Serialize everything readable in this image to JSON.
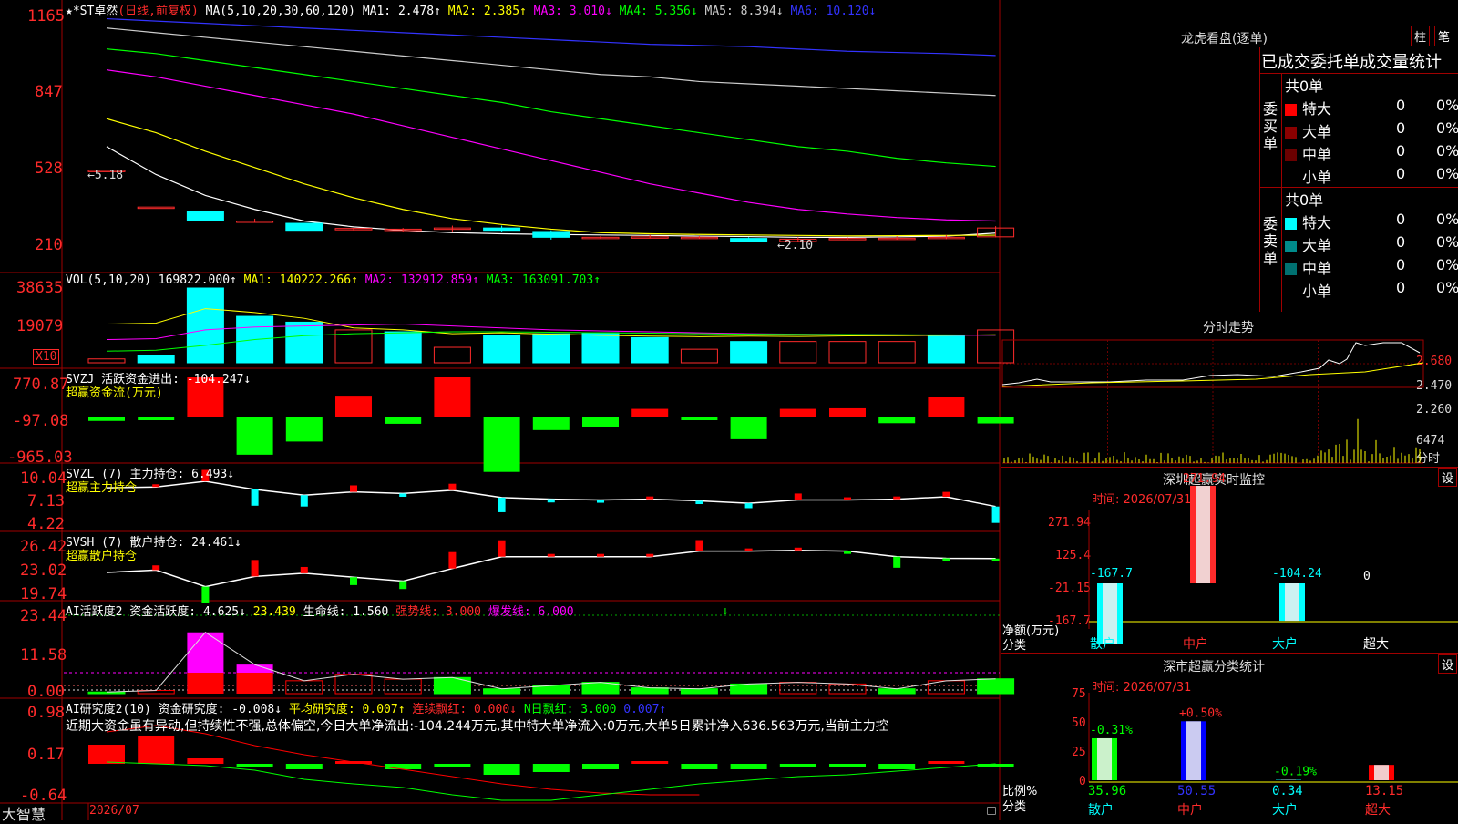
{
  "colors": {
    "up": "#ff2b2b",
    "down": "#00ffff",
    "bg": "#000000",
    "border": "#a00000",
    "yellow": "#ffff00",
    "white": "#ffffff",
    "green": "#00ff00",
    "magenta": "#ff00ff"
  },
  "main": {
    "title": "★*ST卓然",
    "period": "(日线,前复权)",
    "ma_head": "MA(5,10,20,30,60,120)",
    "ma": [
      {
        "label": "MA1: 2.478↑",
        "color": "#ffffff"
      },
      {
        "label": "MA2: 2.385↑",
        "color": "#ffff00"
      },
      {
        "label": "MA3: 3.010↓",
        "color": "#ff00ff"
      },
      {
        "label": "MA4: 5.356↓",
        "color": "#00ff00"
      },
      {
        "label": "MA5: 8.394↓",
        "color": "#cccccc"
      },
      {
        "label": "MA6: 10.120↓",
        "color": "#3333ff"
      }
    ],
    "yticks": [
      "1165",
      "847",
      "528",
      "210"
    ],
    "hi_mark": "←5.18",
    "lo_mark": "←2.10"
  },
  "vol": {
    "head": "VOL(5,10,20)",
    "value": "169822.000↑",
    "ma1": "MA1: 140222.266↑",
    "ma2": "MA2: 132912.859↑",
    "ma3": "MA3: 163091.703↑",
    "yticks": [
      "38635",
      "19079"
    ],
    "unit": "X10"
  },
  "svzj": {
    "head": "SVZJ  活跃资金进出: -104.247↓",
    "sub": "超赢资金流(万元)",
    "yticks": [
      "770.87",
      "-97.08",
      "-965.03"
    ]
  },
  "svzl": {
    "head": "SVZL (7) 主力持仓: 6.493↓",
    "sub": "超赢主力持仓",
    "yticks": [
      "10.04",
      "7.13",
      "4.22"
    ]
  },
  "svsh": {
    "head": "SVSH (7) 散户持仓: 24.461↓",
    "sub": "超赢散户持仓",
    "yticks": [
      "26.42",
      "23.02",
      "19.74"
    ]
  },
  "ai1": {
    "head": "AI活跃度2 资金活跃度:",
    "v1": "4.625↓",
    "v2": "23.439",
    "life": "生命线: 1.560",
    "strong": "强势线: 3.000",
    "burst": "爆发线: 6.000",
    "yticks": [
      "23.44",
      "11.58",
      "0.00"
    ]
  },
  "ai2": {
    "head": "AI研究度2(10) 资金研究度:",
    "v1": "-0.008↓",
    "avg": "平均研究度: 0.007↑",
    "lian": "连续飘红: 0.000↓",
    "nday": "N日飘红: 3.000",
    "last": "0.007↑",
    "comment": "近期大资金虽有异动,但持续性不强,总体偏空,今日大单净流出:-104.244万元,其中特大单净流入:0万元,大单5日累计净入636.563万元,当前主力控",
    "yticks": [
      "0.98",
      "0.17",
      "-0.64"
    ]
  },
  "bottom": {
    "brand": "大智慧",
    "date": "2026/07"
  },
  "chart_data": [
    {
      "type": "candlestick",
      "title": "★*ST卓然",
      "yticks": [
        1165,
        847,
        528,
        210
      ],
      "ohlc": [
        [
          5.18,
          5.18,
          5.18,
          5.18
        ],
        [
          3.6,
          3.6,
          3.6,
          3.6
        ],
        [
          3.4,
          3.4,
          3.0,
          3.0
        ],
        [
          3.0,
          3.1,
          2.95,
          3.0
        ],
        [
          2.9,
          2.9,
          2.6,
          2.6
        ],
        [
          2.62,
          2.7,
          2.6,
          2.68
        ],
        [
          2.6,
          2.7,
          2.55,
          2.65
        ],
        [
          2.65,
          2.8,
          2.55,
          2.7
        ],
        [
          2.7,
          2.8,
          2.55,
          2.6
        ],
        [
          2.55,
          2.6,
          2.2,
          2.3
        ],
        [
          2.3,
          2.35,
          2.25,
          2.3
        ],
        [
          2.3,
          2.4,
          2.25,
          2.32
        ],
        [
          2.3,
          2.35,
          2.25,
          2.3
        ],
        [
          2.25,
          2.3,
          2.1,
          2.12
        ],
        [
          2.12,
          2.3,
          2.1,
          2.22
        ],
        [
          2.22,
          2.3,
          2.2,
          2.25
        ],
        [
          2.24,
          2.34,
          2.2,
          2.26
        ],
        [
          2.26,
          2.4,
          2.22,
          2.3
        ],
        [
          2.32,
          2.78,
          2.3,
          2.7
        ]
      ],
      "ma": [
        {
          "name": "MA1",
          "values": [
            6.2,
            5.0,
            4.1,
            3.5,
            3.0,
            2.75,
            2.6,
            2.5,
            2.45,
            2.42,
            2.4,
            2.38,
            2.35,
            2.33,
            2.3,
            2.3,
            2.32,
            2.35,
            2.48
          ]
        },
        {
          "name": "MA2",
          "values": [
            7.4,
            6.8,
            6.0,
            5.3,
            4.6,
            4.0,
            3.5,
            3.1,
            2.85,
            2.65,
            2.5,
            2.45,
            2.42,
            2.4,
            2.38,
            2.36,
            2.37,
            2.38,
            2.39
          ]
        },
        {
          "name": "MA3",
          "values": [
            9.5,
            9.2,
            8.8,
            8.4,
            8.0,
            7.6,
            7.1,
            6.6,
            6.1,
            5.6,
            5.1,
            4.6,
            4.2,
            3.8,
            3.5,
            3.3,
            3.15,
            3.05,
            3.0
          ]
        },
        {
          "name": "MA4",
          "values": [
            10.4,
            10.2,
            9.9,
            9.6,
            9.3,
            9.0,
            8.7,
            8.4,
            8.1,
            7.7,
            7.4,
            7.1,
            6.8,
            6.5,
            6.2,
            6.0,
            5.7,
            5.5,
            5.35
          ]
        },
        {
          "name": "MA5",
          "values": [
            11.3,
            11.1,
            10.9,
            10.7,
            10.5,
            10.3,
            10.1,
            9.9,
            9.7,
            9.5,
            9.3,
            9.2,
            9.0,
            8.9,
            8.8,
            8.7,
            8.6,
            8.5,
            8.4
          ]
        },
        {
          "name": "MA6",
          "values": [
            11.7,
            11.6,
            11.5,
            11.4,
            11.3,
            11.2,
            11.1,
            11.0,
            10.9,
            10.8,
            10.7,
            10.6,
            10.55,
            10.5,
            10.4,
            10.3,
            10.25,
            10.2,
            10.12
          ]
        }
      ]
    },
    {
      "type": "bar",
      "title": "VOL",
      "yticks": [
        38635,
        19079
      ],
      "values": [
        2000,
        4000,
        38635,
        24000,
        21000,
        17000,
        16000,
        8000,
        14000,
        15000,
        15500,
        13000,
        7000,
        11000,
        11000,
        11000,
        11000,
        14000,
        16982
      ]
    },
    {
      "type": "bar",
      "title": "SVZJ",
      "yticks": [
        770.87,
        -97.08,
        -965.03
      ],
      "values": [
        -60,
        -40,
        700,
        -650,
        -420,
        380,
        -110,
        700,
        -950,
        -220,
        -160,
        150,
        -20,
        -380,
        150,
        160,
        -100,
        360,
        -104
      ]
    },
    {
      "type": "line",
      "title": "SVZL",
      "yticks": [
        10.04,
        7.13,
        4.22
      ],
      "values": [
        8.8,
        8.9,
        9.6,
        8.6,
        7.9,
        8.3,
        8.1,
        8.5,
        7.6,
        7.4,
        7.3,
        7.4,
        7.2,
        6.9,
        7.3,
        7.3,
        7.4,
        7.7,
        6.5
      ]
    },
    {
      "type": "line",
      "title": "SVSH",
      "yticks": [
        26.42,
        23.02,
        19.74
      ],
      "values": [
        22.7,
        23.0,
        20.9,
        22.2,
        22.6,
        22.1,
        21.6,
        23.2,
        24.7,
        24.7,
        24.7,
        24.7,
        25.4,
        25.4,
        25.5,
        25.4,
        24.7,
        24.5,
        24.46
      ]
    },
    {
      "type": "bar",
      "title": "AI活跃度2",
      "yticks": [
        23.44,
        11.58,
        0.0
      ],
      "values": [
        0.5,
        1.0,
        19.0,
        9.0,
        4.0,
        6.0,
        4.5,
        5.0,
        1.5,
        2.5,
        3.5,
        1.8,
        1.5,
        3.0,
        3.5,
        3.0,
        1.5,
        4.0,
        4.6
      ]
    },
    {
      "type": "bar",
      "title": "AI研究度2",
      "yticks": [
        0.98,
        0.17,
        -0.64
      ],
      "values": [
        0.35,
        0.5,
        0.1,
        -0.05,
        -0.1,
        0.0,
        -0.1,
        -0.05,
        -0.2,
        -0.15,
        -0.1,
        0.0,
        -0.1,
        -0.1,
        -0.05,
        -0.05,
        -0.1,
        0.05,
        -0.008
      ]
    }
  ],
  "side": {
    "lhb": {
      "title": "龙虎看盘(逐单)",
      "btn_bar": "柱",
      "btn_pen": "笔",
      "tabs": [
        "已成交",
        "委托单",
        "成交量统计"
      ],
      "buy_label": "委买单",
      "sell_label": "委卖单",
      "buy_total": "共0单",
      "sell_total": "共0单",
      "buy_rows": [
        {
          "label": "特大",
          "n": "0",
          "pct": "0%",
          "color": "#ff0000"
        },
        {
          "label": "大单",
          "n": "0",
          "pct": "0%",
          "color": "#8b0000"
        },
        {
          "label": "中单",
          "n": "0",
          "pct": "0%",
          "color": "#6b0000"
        },
        {
          "label": "小单",
          "n": "0",
          "pct": "0%",
          "color": "#000000"
        }
      ],
      "sell_rows": [
        {
          "label": "特大",
          "n": "0",
          "pct": "0%",
          "color": "#00ffff"
        },
        {
          "label": "大单",
          "n": "0",
          "pct": "0%",
          "color": "#008b8b"
        },
        {
          "label": "中单",
          "n": "0",
          "pct": "0%",
          "color": "#007070"
        },
        {
          "label": "小单",
          "n": "0",
          "pct": "0%",
          "color": "#000000"
        }
      ]
    },
    "intraday": {
      "title": "分时走势",
      "yticks": [
        "2.680",
        "2.470",
        "2.260"
      ],
      "vol_tick": "6474",
      "vol_label": "分时"
    },
    "monitor": {
      "title": "深圳超赢实时监控",
      "set": "设",
      "time": "时间: 2026/07/31",
      "yticks": [
        "271.94",
        "125.4",
        "-21.15",
        "-167.7"
      ],
      "unit": "净额(万元)",
      "cat_head": "分类",
      "categories": [
        "散户",
        "中户",
        "大户",
        "超大"
      ],
      "values": [
        -167.7,
        271.94,
        -104.24,
        0
      ],
      "value_labels": [
        "-167.7",
        "271.94",
        "-104.24",
        "0"
      ]
    },
    "classify": {
      "title": "深市超赢分类统计",
      "set": "设",
      "time": "时间: 2026/07/31",
      "yticks": [
        "75",
        "50",
        "25",
        "0"
      ],
      "unit": "比例%",
      "cat_head": "分类",
      "categories": [
        "散户",
        "中户",
        "大户",
        "超大"
      ],
      "values": [
        35.96,
        50.55,
        0.34,
        13.15
      ],
      "value_labels": [
        "35.96",
        "50.55",
        "0.34",
        "13.15"
      ],
      "delta_labels": [
        "-0.31%",
        "+0.50%",
        "-0.19%",
        ""
      ]
    }
  }
}
